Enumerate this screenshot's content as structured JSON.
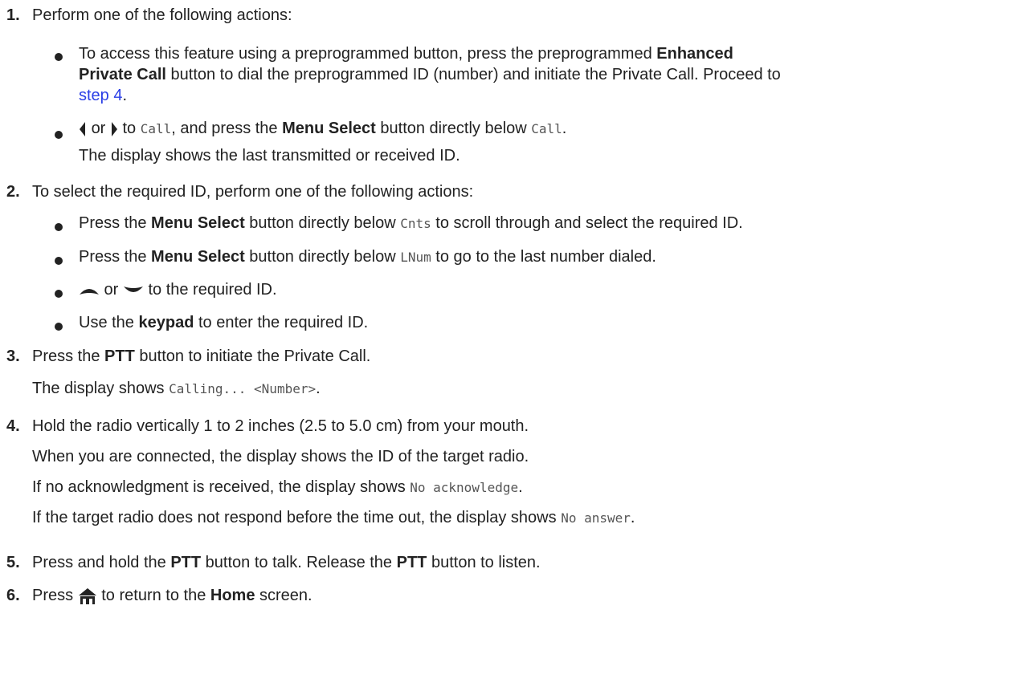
{
  "steps": [
    {
      "number": "1.",
      "text": "Perform one of the following actions:"
    },
    {
      "number": "2.",
      "text": "To select the required ID, perform one of the following actions:"
    },
    {
      "number": "3.",
      "pre": "Press the ",
      "bold": "PTT",
      "post": " button to initiate the Private Call.",
      "note_pre": "The display shows ",
      "note_mono": "Calling... <Number>",
      "note_post": "."
    },
    {
      "number": "4.",
      "text": "Hold the radio vertically 1 to 2 inches (2.5 to 5.0 cm) from your mouth.",
      "note1": "When you are connected, the display shows the ID of the target radio.",
      "note2_pre": "If no acknowledgment is received, the display shows ",
      "note2_mono": "No acknowledge",
      "note2_post": ".",
      "note3_pre": "If the target radio does not respond before the time out, the display shows ",
      "note3_mono": "No answer",
      "note3_post": "."
    },
    {
      "number": "5.",
      "pre": "Press and hold the ",
      "bold1": "PTT",
      "mid": " button to talk. Release the ",
      "bold2": "PTT",
      "post": " button to listen."
    },
    {
      "number": "6.",
      "pre": "Press ",
      "mid": " to return to the ",
      "bold": "Home",
      "post": " screen."
    }
  ],
  "step1_bullets": {
    "b1": {
      "l1_pre": "To access this feature using a preprogrammed button, press the preprogrammed ",
      "l1_bold": "Enhanced",
      "l2_bold": "Private Call",
      "l2_post": " button to dial the preprogrammed ID (number) and initiate the Private Call. Proceed to",
      "l3_link": "step 4",
      "l3_post": "."
    },
    "b2": {
      "or": "or",
      "to": " to ",
      "mono1": "Call",
      "mid": ", and press the ",
      "bold": "Menu Select",
      "post": " button directly below ",
      "mono2": "Call",
      "end": ".",
      "note": "The display shows the last transmitted or received ID."
    }
  },
  "step2_bullets": {
    "b1": {
      "pre": "Press the ",
      "bold": "Menu Select",
      "mid": " button directly below ",
      "mono": "Cnts",
      "post": " to scroll through and select the required ID."
    },
    "b2": {
      "pre": "Press the ",
      "bold": "Menu Select",
      "mid": " button directly below ",
      "mono": "LNum",
      "post": " to go to the last number dialed."
    },
    "b3": {
      "or": " or ",
      "post": " to the required ID."
    },
    "b4": {
      "pre": "Use the ",
      "bold": "keypad",
      "post": " to enter the required ID."
    }
  },
  "icons": [
    "left-arrow-icon",
    "right-arrow-icon",
    "up-arrow-icon",
    "down-arrow-icon",
    "home-icon"
  ],
  "colors": {
    "text": "#222222",
    "link": "#2a3ee6",
    "mono": "#555555"
  }
}
